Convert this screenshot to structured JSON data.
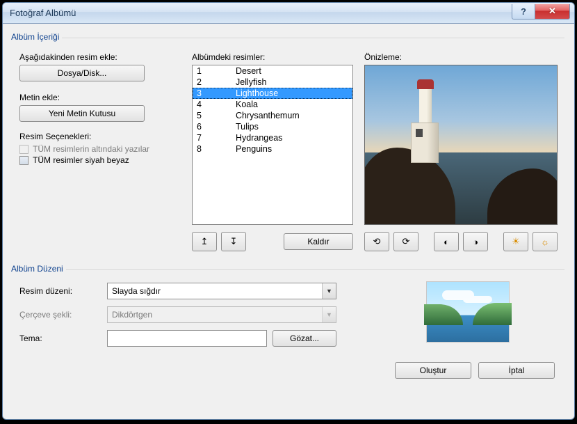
{
  "title": "Fotoğraf Albümü",
  "content_group": {
    "legend": "Albüm İçeriği"
  },
  "insert_from": {
    "label": "Aşağıdakinden resim ekle:",
    "file_disk_btn": "Dosya/Disk..."
  },
  "insert_text": {
    "label": "Metin ekle:",
    "textbox_btn": "Yeni Metin Kutusu"
  },
  "picture_options": {
    "label": "Resim Seçenekleri:",
    "captions": "TÜM resimlerin altındaki yazılar",
    "bw": "TÜM resimler siyah beyaz"
  },
  "pictures": {
    "label": "Albümdeki resimler:",
    "items": [
      {
        "n": "1",
        "name": "Desert"
      },
      {
        "n": "2",
        "name": "Jellyfish"
      },
      {
        "n": "3",
        "name": "Lighthouse"
      },
      {
        "n": "4",
        "name": "Koala"
      },
      {
        "n": "5",
        "name": "Chrysanthemum"
      },
      {
        "n": "6",
        "name": "Tulips"
      },
      {
        "n": "7",
        "name": "Hydrangeas"
      },
      {
        "n": "8",
        "name": "Penguins"
      }
    ],
    "selected_index": 2,
    "remove_btn": "Kaldır"
  },
  "preview": {
    "label": "Önizleme:"
  },
  "layout_group": {
    "legend": "Albüm Düzeni"
  },
  "layout": {
    "picture_layout_label": "Resim düzeni:",
    "picture_layout_value": "Slayda sığdır",
    "frame_shape_label": "Çerçeve şekli:",
    "frame_shape_value": "Dikdörtgen",
    "theme_label": "Tema:",
    "theme_value": "",
    "browse_btn": "Gözat..."
  },
  "footer": {
    "create": "Oluştur",
    "cancel": "İptal"
  },
  "icons": {
    "up": "↥",
    "down": "↧",
    "rot_left": "⟲",
    "rot_right": "⟳",
    "contrast_up": "◐",
    "contrast_down": "◑",
    "bright_up": "☀",
    "bright_down": "☼"
  }
}
